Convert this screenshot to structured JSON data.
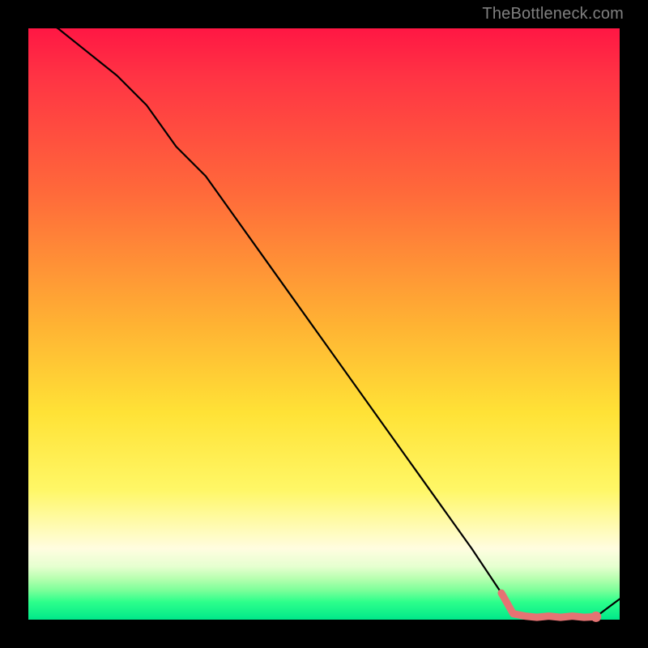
{
  "watermark": "TheBottleneck.com",
  "chart_data": {
    "type": "line",
    "title": "",
    "xlabel": "",
    "ylabel": "",
    "xlim": [
      0,
      100
    ],
    "ylim": [
      0,
      100
    ],
    "grid": false,
    "legend": false,
    "series": [
      {
        "name": "bottleneck-curve",
        "color": "#000000",
        "x": [
          0,
          5,
          10,
          15,
          20,
          25,
          30,
          35,
          40,
          45,
          50,
          55,
          60,
          65,
          70,
          75,
          80,
          82,
          84,
          86,
          88,
          90,
          92,
          94,
          96,
          98,
          100
        ],
        "values": [
          103,
          100,
          96,
          92,
          87,
          80,
          75,
          68,
          61,
          54,
          47,
          40,
          33,
          26,
          19,
          12,
          4.5,
          1.0,
          0.6,
          0.4,
          0.6,
          0.4,
          0.6,
          0.4,
          0.5,
          2.0,
          3.5
        ]
      }
    ],
    "flat_segment": {
      "name": "low-bottleneck-zone",
      "color": "#e57373",
      "x": [
        80,
        82,
        84,
        86,
        88,
        90,
        92,
        94,
        96
      ],
      "values": [
        4.5,
        1.0,
        0.6,
        0.4,
        0.6,
        0.4,
        0.6,
        0.4,
        0.5
      ]
    },
    "end_marker": {
      "name": "end-point",
      "color": "#e57373",
      "x": 96,
      "value": 0.5
    }
  }
}
